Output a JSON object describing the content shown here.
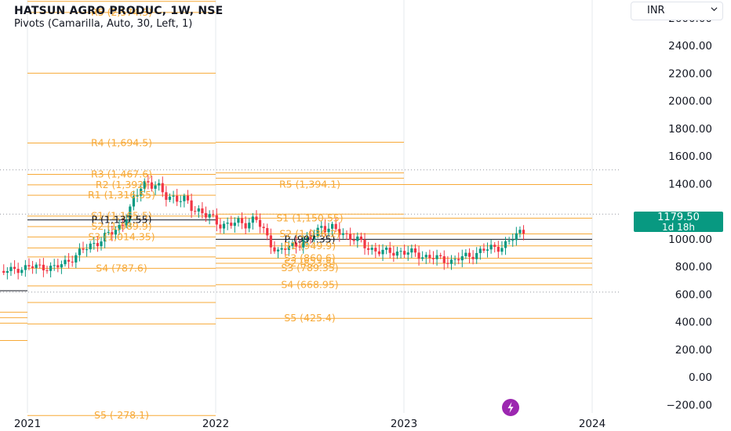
{
  "header": {
    "title": "HATSUN AGRO PRODUC, 1W, NSE",
    "indicator": "Pivots (Camarilla, Auto, 30, Left, 1)"
  },
  "currency_selector": {
    "label": "INR",
    "icon": "chevron-down-icon"
  },
  "last_price": {
    "value": "1179.50",
    "countdown": "1d 18h",
    "color": "#089981"
  },
  "flash_button": {
    "icon": "lightning-icon",
    "color": "#9c27b0"
  },
  "colors": {
    "pivot": "#f7a937",
    "pivot_p": "#131722",
    "up": "#089981",
    "down": "#f23645"
  },
  "chart_data": {
    "type": "candlestick",
    "y_axis": {
      "range": [
        -260,
        2730
      ],
      "ticks": [
        {
          "value": 2600,
          "label": "2600.00"
        },
        {
          "value": 2400,
          "label": "2400.00"
        },
        {
          "value": 2200,
          "label": "2200.00"
        },
        {
          "value": 2000,
          "label": "2000.00"
        },
        {
          "value": 1800,
          "label": "1800.00"
        },
        {
          "value": 1600,
          "label": "1600.00"
        },
        {
          "value": 1400,
          "label": "1400.00"
        },
        {
          "value": 1000,
          "label": "1000.00"
        },
        {
          "value": 800,
          "label": "800.00"
        },
        {
          "value": 600,
          "label": "600.00"
        },
        {
          "value": 400,
          "label": "400.00"
        },
        {
          "value": 200,
          "label": "200.00"
        },
        {
          "value": 0,
          "label": "0.00"
        },
        {
          "value": -200,
          "label": "−200.00"
        }
      ]
    },
    "x_axis": {
      "ticks": [
        {
          "label": "2021",
          "date": "2021-01-01"
        },
        {
          "label": "2022",
          "date": "2022-01-01"
        },
        {
          "label": "2023",
          "date": "2023-01-01"
        },
        {
          "label": "2024",
          "date": "2024-01-01"
        }
      ]
    },
    "dotted_levels": [
      1500,
      1180,
      615
    ],
    "pivot_periods": [
      {
        "start": "2020-01-01",
        "end": "2021-01-01",
        "levels": [
          {
            "name": "P",
            "value": 625,
            "label": ""
          },
          {
            "name": "S2",
            "value": 470,
            "label": ""
          },
          {
            "name": "S3",
            "value": 430,
            "label": ""
          },
          {
            "name": "S4",
            "value": 390,
            "label": ""
          },
          {
            "name": "S5",
            "value": 265,
            "label": ""
          }
        ]
      },
      {
        "start": "2021-01-01",
        "end": "2022-01-01",
        "levels": [
          {
            "name": "R5",
            "value": 2720,
            "label": ""
          },
          {
            "name": "R4c",
            "value": 2640,
            "label": "R5 (2,574.3)"
          },
          {
            "name": "R5x",
            "value": 2200,
            "label": ""
          },
          {
            "name": "R4",
            "value": 1694.5,
            "label": "R4 (1,694.5)"
          },
          {
            "name": "R3",
            "value": 1467.6,
            "label": "R3 (1,467.6)"
          },
          {
            "name": "R2",
            "value": 1392,
            "label": "R2 (1,392)"
          },
          {
            "name": "R1",
            "value": 1316.55,
            "label": "R1 (1,316.55)"
          },
          {
            "name": "S1",
            "value": 1165.5,
            "label": "S1 (1,165.5)"
          },
          {
            "name": "P",
            "value": 1137.55,
            "label": "P (1,137.55)"
          },
          {
            "name": "S2",
            "value": 1089.9,
            "label": "S2 (1,089.9)"
          },
          {
            "name": "S3",
            "value": 1014.35,
            "label": "S3 (1,014.35)"
          },
          {
            "name": "S3b",
            "value": 935,
            "label": ""
          },
          {
            "name": "S3c",
            "value": 870,
            "label": ""
          },
          {
            "name": "S4",
            "value": 787.6,
            "label": "S4 (787.6)"
          },
          {
            "name": "S4b",
            "value": 660,
            "label": ""
          },
          {
            "name": "S4c",
            "value": 540,
            "label": ""
          },
          {
            "name": "S4d",
            "value": 385,
            "label": ""
          },
          {
            "name": "S5",
            "value": -278.1,
            "label": "S5 (-278.1)"
          }
        ]
      },
      {
        "start": "2022-01-01",
        "end": "2023-01-01",
        "levels": [
          {
            "name": "R4",
            "value": 1700,
            "label": ""
          },
          {
            "name": "R3",
            "value": 1478,
            "label": ""
          },
          {
            "name": "R2",
            "value": 1440,
            "label": ""
          },
          {
            "name": "R5",
            "value": 1394.1,
            "label": "R5 (1,394.1)"
          },
          {
            "name": "R1",
            "value": 1180,
            "label": ""
          },
          {
            "name": "S1",
            "value": 1150.55,
            "label": "S1 (1,150.55)"
          },
          {
            "name": "P",
            "value": 997.35,
            "label": "P (997.35)"
          },
          {
            "name": "S2",
            "value": 1036.2,
            "label": "S2 (1,036.2)"
          },
          {
            "name": "R1b",
            "value": 949.9,
            "label": "R1 (949.9)"
          },
          {
            "name": "S3",
            "value": 860.6,
            "label": "S3 (860.6)"
          },
          {
            "name": "S2b",
            "value": 823.8,
            "label": "S2 (823.8)"
          },
          {
            "name": "S3b",
            "value": 789.35,
            "label": "S3 (789.35)"
          },
          {
            "name": "S4",
            "value": 668.95,
            "label": "S4 (668.95)"
          },
          {
            "name": "S5",
            "value": 425.4,
            "label": "S5 (425.4)"
          }
        ]
      },
      {
        "start": "2023-01-01",
        "end": "2024-01-01",
        "levels": [
          {
            "name": "R5",
            "value": 1394.1,
            "label": ""
          },
          {
            "name": "R1",
            "value": 1150.55,
            "label": ""
          },
          {
            "name": "R0",
            "value": 1036.2,
            "label": ""
          },
          {
            "name": "P",
            "value": 997.35,
            "label": ""
          },
          {
            "name": "S1",
            "value": 949.9,
            "label": ""
          },
          {
            "name": "S2",
            "value": 860.6,
            "label": ""
          },
          {
            "name": "S3",
            "value": 823.8,
            "label": ""
          },
          {
            "name": "S3b",
            "value": 789.35,
            "label": ""
          },
          {
            "name": "S4",
            "value": 668.95,
            "label": ""
          },
          {
            "name": "S5",
            "value": 425.4,
            "label": ""
          }
        ]
      }
    ],
    "anchors": [
      [
        "2020-10-05",
        730
      ],
      [
        "2020-11-15",
        760
      ],
      [
        "2020-12-20",
        790
      ],
      [
        "2021-01-20",
        800
      ],
      [
        "2021-02-25",
        790
      ],
      [
        "2021-04-05",
        880
      ],
      [
        "2021-05-05",
        960
      ],
      [
        "2021-06-01",
        1010
      ],
      [
        "2021-07-01",
        1100
      ],
      [
        "2021-07-20",
        1210
      ],
      [
        "2021-08-10",
        1400
      ],
      [
        "2021-08-25",
        1420
      ],
      [
        "2021-09-15",
        1340
      ],
      [
        "2021-10-20",
        1290
      ],
      [
        "2021-11-20",
        1230
      ],
      [
        "2021-12-25",
        1140
      ],
      [
        "2022-01-20",
        1100
      ],
      [
        "2022-02-25",
        1120
      ],
      [
        "2022-03-20",
        1140
      ],
      [
        "2022-04-10",
        1020
      ],
      [
        "2022-05-01",
        900
      ],
      [
        "2022-06-01",
        960
      ],
      [
        "2022-07-05",
        1000
      ],
      [
        "2022-07-25",
        1100
      ],
      [
        "2022-08-20",
        1060
      ],
      [
        "2022-09-20",
        1020
      ],
      [
        "2022-10-20",
        940
      ],
      [
        "2022-11-25",
        900
      ],
      [
        "2022-12-25",
        910
      ],
      [
        "2023-01-25",
        890
      ],
      [
        "2023-03-01",
        860
      ],
      [
        "2023-04-05",
        840
      ],
      [
        "2023-05-15",
        890
      ],
      [
        "2023-06-15",
        930
      ],
      [
        "2023-07-20",
        960
      ],
      [
        "2023-08-10",
        1040
      ],
      [
        "2023-09-01",
        1100
      ],
      [
        "2023-09-14",
        1179.5
      ]
    ]
  }
}
